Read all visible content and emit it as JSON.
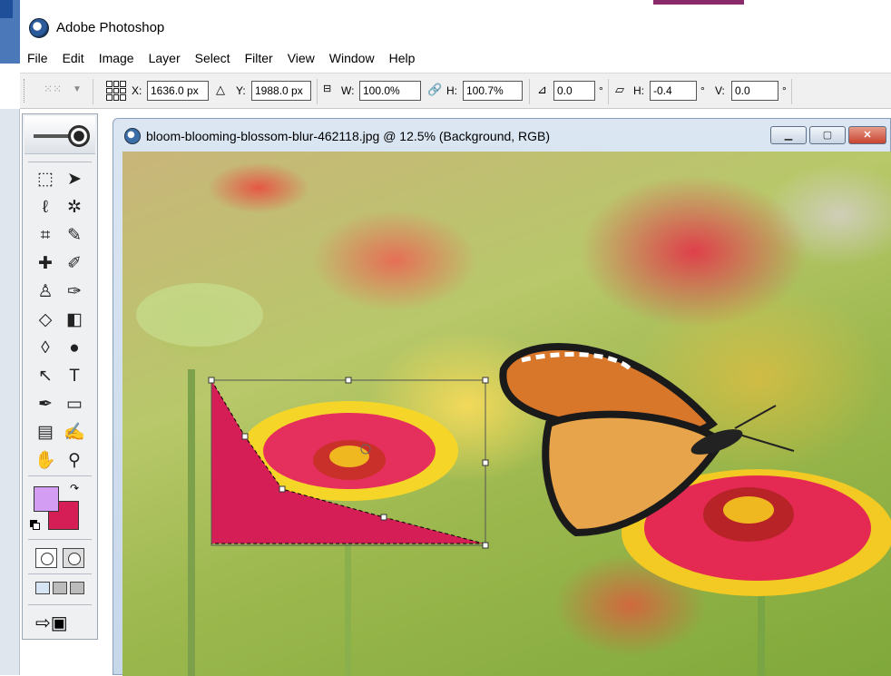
{
  "app": {
    "title": "Adobe Photoshop"
  },
  "menu": [
    "File",
    "Edit",
    "Image",
    "Layer",
    "Select",
    "Filter",
    "View",
    "Window",
    "Help"
  ],
  "options": {
    "x_label": "X:",
    "x_value": "1636.0 px",
    "y_label": "Y:",
    "y_value": "1988.0 px",
    "w_label": "W:",
    "w_value": "100.0%",
    "h_label": "H:",
    "h_value": "100.7%",
    "angle_value": "0.0",
    "skew_h_label": "H:",
    "skew_h_value": "-0.4",
    "skew_v_label": "V:",
    "skew_v_value": "0.0",
    "degree": "°"
  },
  "document": {
    "title": "bloom-blooming-blossom-blur-462118.jpg @ 12.5% (Background, RGB)"
  },
  "colors": {
    "foreground": "#d29df2",
    "background": "#d51e55",
    "selection_fill": "#d51e55"
  },
  "icons": {
    "window_minimize": "minimize-icon",
    "window_maximize": "maximize-icon",
    "window_close": "close-icon"
  }
}
